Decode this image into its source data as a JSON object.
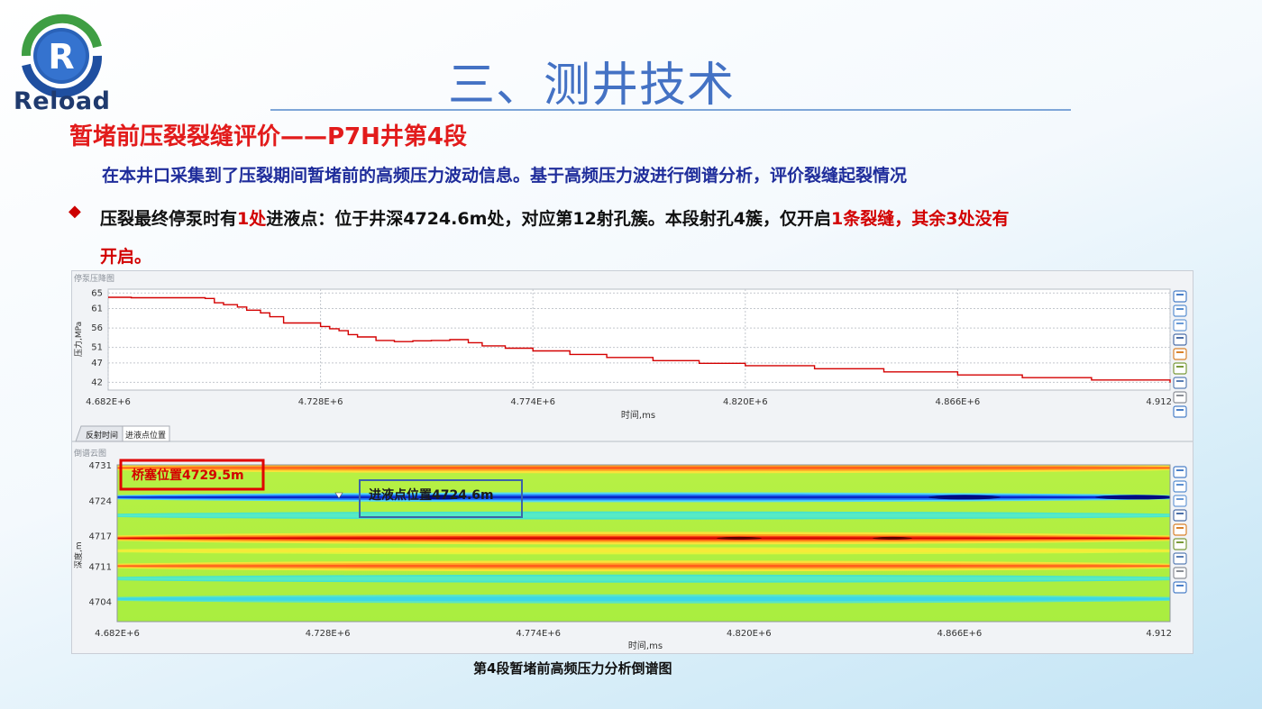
{
  "brand": {
    "logo_letter": "R",
    "logo_text": "Reload"
  },
  "slide": {
    "title": "三、测井技术",
    "subtitle": "暂堵前压裂裂缝评价——P7H井第4段",
    "lead": "在本井口采集到了压裂期间暂堵前的高频压力波动信息。基于高频压力波进行倒谱分析，评价裂缝起裂情况",
    "bullet_icon": "diamond-bullet-icon",
    "para": {
      "p1": "压裂最终停泵时有",
      "p1_red": "1处",
      "p2": "进液点：位于井深4724.6m处，对应第12射孔簇。本段射孔4簇，仅开启",
      "p2_red": "1条裂缝，其余3处没有",
      "p3_red": "开启。"
    },
    "caption": "第4段暂堵前高频压力分析倒谱图"
  },
  "accent_colors": {
    "title": "#4472c4",
    "subtitle": "#e21b1b",
    "lead": "#1f2d9b",
    "highlight": "#d20000"
  },
  "toolbar_icons": [
    "table-icon",
    "calendar-icon",
    "zoom-icon",
    "print-icon",
    "image-icon",
    "export-icon",
    "chart-icon",
    "settings-icon",
    "window-icon"
  ],
  "chart_data": [
    {
      "type": "line",
      "title": "停泵压降图",
      "xlabel": "时间,ms",
      "ylabel": "压力,MPa",
      "xlim": [
        4682000,
        4912000
      ],
      "ylim": [
        40,
        66
      ],
      "x_ticks": [
        "4.682E+6",
        "4.728E+6",
        "4.774E+6",
        "4.820E+6",
        "4.866E+6",
        "4.912"
      ],
      "y_ticks": [
        "65",
        "61",
        "56",
        "51",
        "47",
        "42"
      ],
      "line_color": "#d40000",
      "series": [
        {
          "x": [
            4682000,
            4687000,
            4693000,
            4699000,
            4702000,
            4703000,
            4705000,
            4707000,
            4710000,
            4712000,
            4715000,
            4717000,
            4720000,
            4722000,
            4725000,
            4728000,
            4730000,
            4732000,
            4734000,
            4736000,
            4740000,
            4744000,
            4748000,
            4752000,
            4756000,
            4760000,
            4763000,
            4768000,
            4774000,
            4782000,
            4790000,
            4800000,
            4810000,
            4820000,
            4835000,
            4850000,
            4866000,
            4880000,
            4895000,
            4912000
          ],
          "y": [
            63.9,
            63.8,
            63.8,
            63.8,
            63.8,
            63.6,
            62.5,
            62.0,
            61.4,
            60.6,
            59.9,
            58.9,
            57.3,
            57.3,
            57.3,
            56.4,
            55.8,
            55.3,
            54.3,
            53.7,
            52.8,
            52.5,
            52.7,
            52.8,
            53.0,
            52.2,
            51.4,
            50.8,
            50.1,
            49.2,
            48.4,
            47.6,
            46.9,
            46.3,
            45.5,
            44.7,
            43.9,
            43.2,
            42.6,
            41.9
          ]
        }
      ]
    },
    {
      "type": "heatmap",
      "title": "倒谱云图",
      "tabs": [
        "反射时间",
        "进液点位置"
      ],
      "active_tab": "进液点位置",
      "xlabel": "时间,ms",
      "ylabel": "深度,m",
      "xlim": [
        4682000,
        4912000
      ],
      "ylim": [
        4700,
        4731
      ],
      "x_ticks": [
        "4.682E+6",
        "4.728E+6",
        "4.774E+6",
        "4.820E+6",
        "4.866E+6",
        "4.912"
      ],
      "y_ticks": [
        "4731",
        "4724",
        "4717",
        "4711",
        "4704"
      ],
      "bands": [
        {
          "depth": 4730.4,
          "tone": "high-orange"
        },
        {
          "depth": 4724.6,
          "tone": "low-blue"
        },
        {
          "depth": 4721.0,
          "tone": "mid-cyan"
        },
        {
          "depth": 4716.5,
          "tone": "high-red"
        },
        {
          "depth": 4714.0,
          "tone": "mid-yellow"
        },
        {
          "depth": 4711.0,
          "tone": "high-orange"
        },
        {
          "depth": 4708.5,
          "tone": "mid-cyan"
        },
        {
          "depth": 4704.5,
          "tone": "low-cyan"
        }
      ],
      "annotations": [
        {
          "text": "桥塞位置4729.5m",
          "depth": 4729.5,
          "color": "#d40000"
        },
        {
          "text": "进液点位置4724.6m",
          "depth": 4724.6,
          "color": "#1b1b1b"
        }
      ]
    }
  ]
}
